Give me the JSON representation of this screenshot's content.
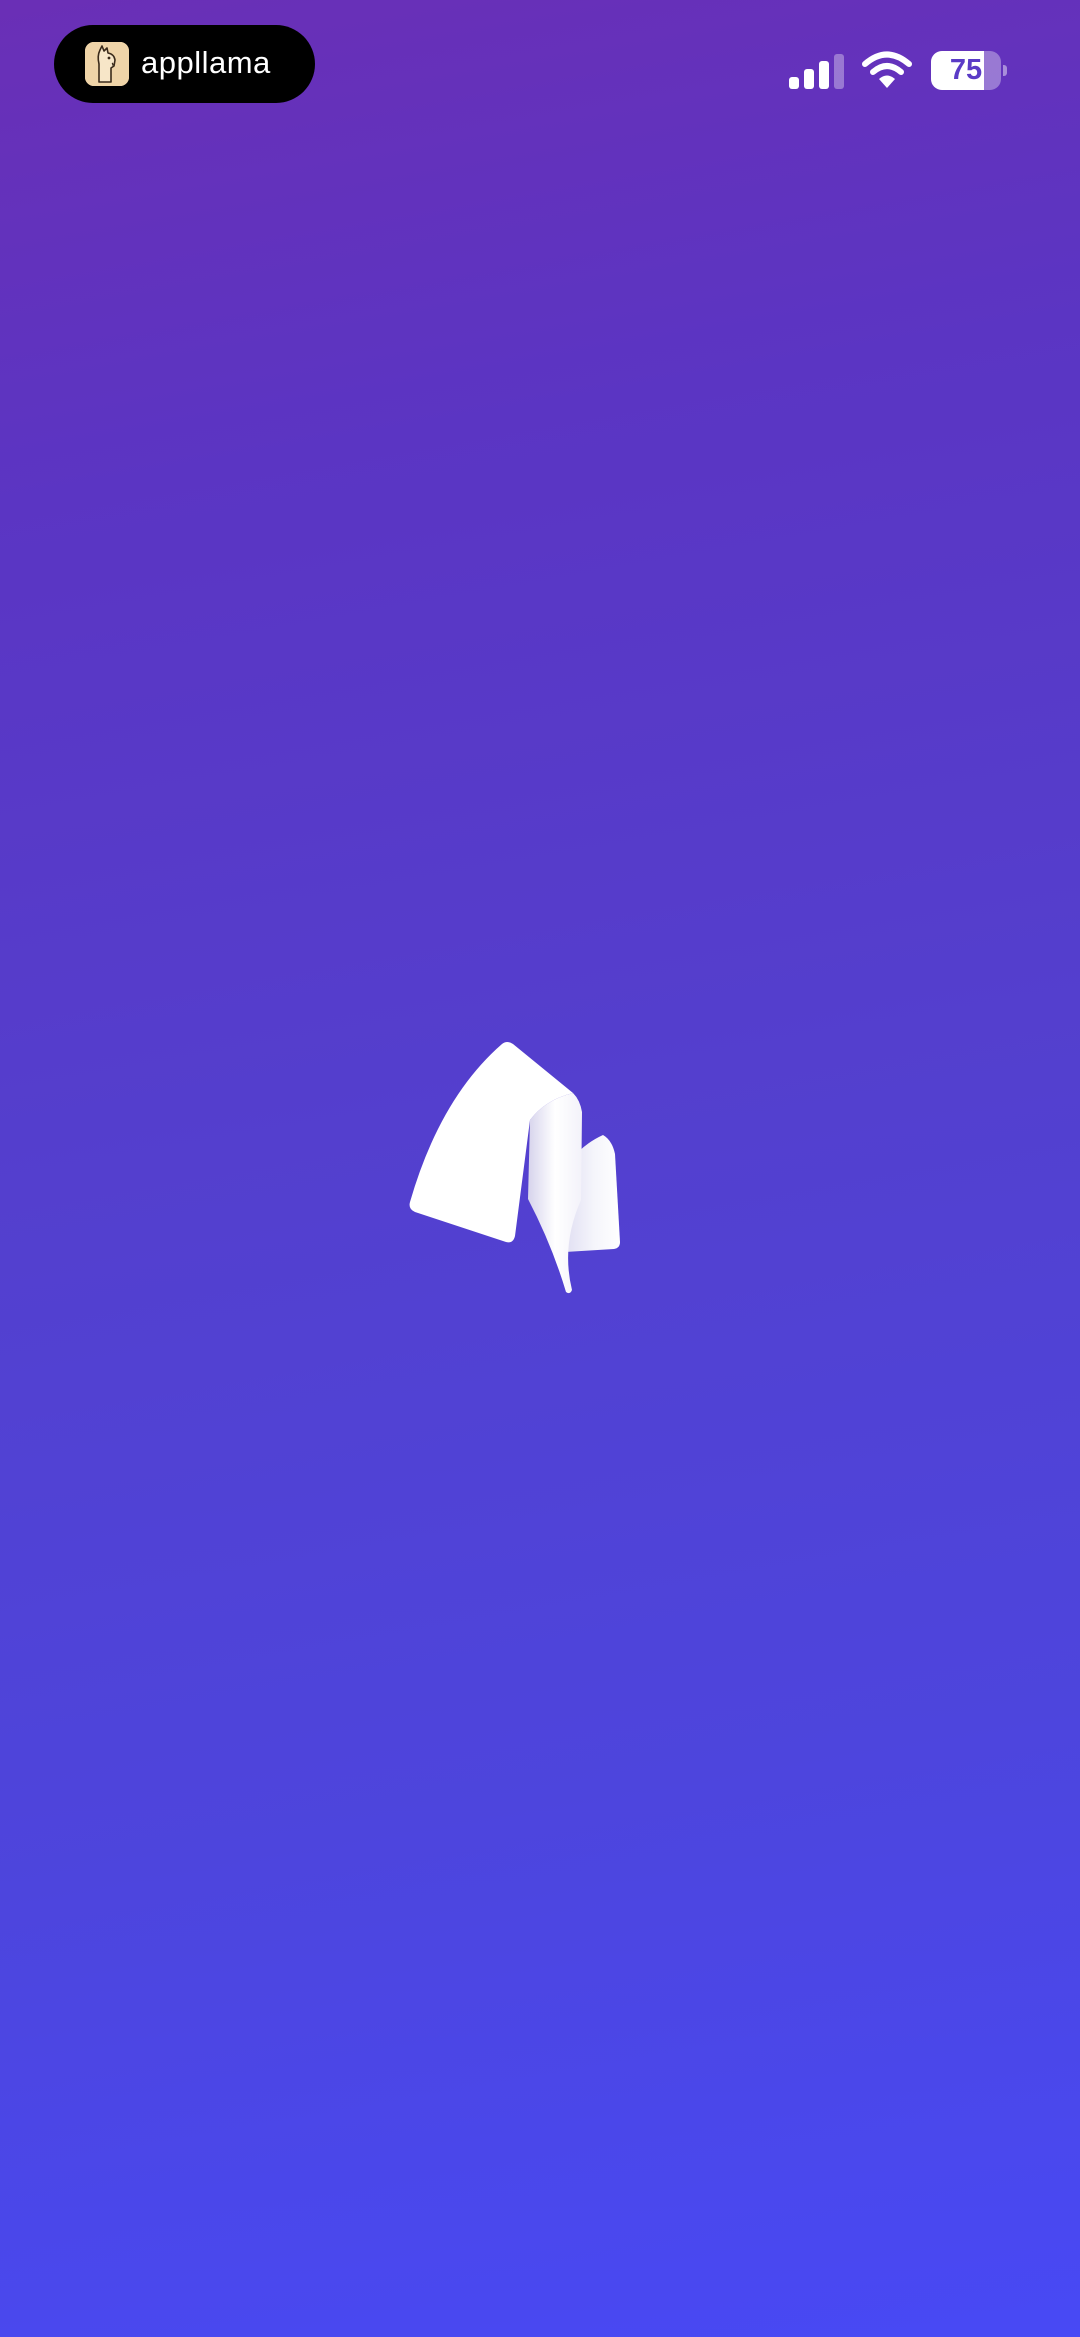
{
  "brand": {
    "name": "appllama",
    "icon": "llama-icon"
  },
  "status_bar": {
    "signal_icon": "cellular-signal-icon",
    "signal_bars_active": 3,
    "signal_bars_total": 4,
    "wifi_icon": "wifi-icon",
    "battery_level": "75",
    "battery_fraction": 0.75
  },
  "splash": {
    "logo_icon": "app-logo-icon"
  },
  "colors": {
    "gradient_top": "#6a2fb6",
    "gradient_bottom": "#4849f5",
    "pill_background": "#000000",
    "logo": "#ffffff"
  }
}
